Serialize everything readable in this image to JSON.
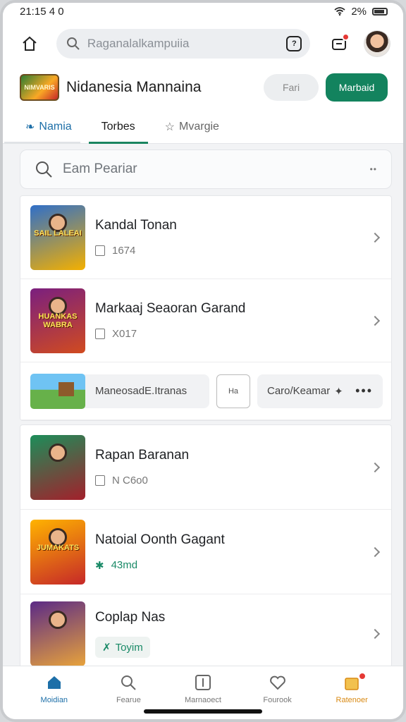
{
  "status_bar": {
    "time": "21:15 4 0",
    "battery_text": "2%"
  },
  "top_bar": {
    "search_placeholder": "Raganalalkampuiia",
    "scan_label": "?"
  },
  "header": {
    "brand_name": "Nidanesia Mannaina",
    "logo_text": "NIMVARIS",
    "ghost_button": "Fari",
    "primary_button": "Marbaid",
    "tabs": [
      {
        "label": "Namia",
        "icon": "feather-icon"
      },
      {
        "label": "Torbes"
      },
      {
        "label": "Mvargie",
        "icon": "star-outline-icon"
      }
    ]
  },
  "filter": {
    "placeholder": "Eam Peariar"
  },
  "games_top": [
    {
      "title": "Kandal Tonan",
      "meta": "1674",
      "thumb_text": "SAIL LALEAI",
      "colors": [
        "#2f6fc9",
        "#f4b000"
      ]
    },
    {
      "title": "Markaaj Seaoran Garand",
      "meta": "X017",
      "thumb_text": "HUANKAS WABRA",
      "colors": [
        "#7a1f7f",
        "#d14b1f"
      ]
    }
  ],
  "featured_strip": {
    "label": "ManeosadE.Itranas",
    "square_label": "Ha",
    "side_label": "Caro/Keamar"
  },
  "games_bottom": [
    {
      "title": "Rapan Baranan",
      "meta": "N C6o0",
      "meta_style": "plain",
      "thumb_text": "",
      "colors": [
        "#1c8e5a",
        "#a3202b"
      ]
    },
    {
      "title": "Natoial Oonth Gagant",
      "meta": "43md",
      "meta_style": "green",
      "thumb_text": "JUMAKATS",
      "colors": [
        "#ffb300",
        "#c62828"
      ]
    },
    {
      "title": "Coplap Nas",
      "meta": "Toyim",
      "meta_style": "badge",
      "thumb_text": "",
      "colors": [
        "#5b2a86",
        "#e8a33b"
      ]
    }
  ],
  "bottom_nav": [
    {
      "label": "Moidian",
      "icon": "home-icon",
      "state": "active"
    },
    {
      "label": "Fearue",
      "icon": "search-icon",
      "state": ""
    },
    {
      "label": "Marnaoect",
      "icon": "add-box-icon",
      "state": ""
    },
    {
      "label": "Fourook",
      "icon": "heart-icon",
      "state": ""
    },
    {
      "label": "Ratenoer",
      "icon": "bag-icon",
      "state": "orange"
    }
  ]
}
